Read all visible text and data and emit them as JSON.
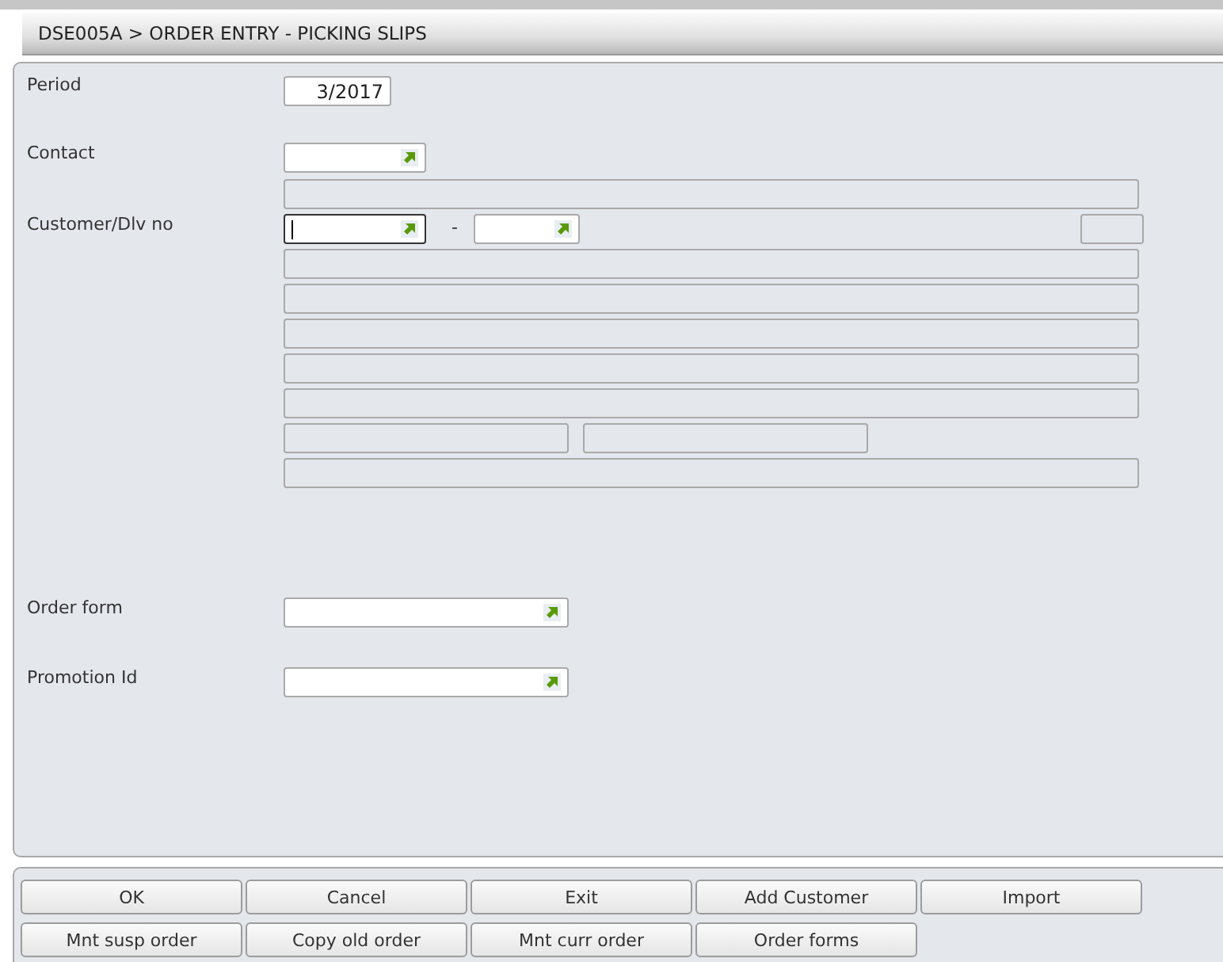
{
  "title": "DSE005A > ORDER ENTRY - PICKING SLIPS",
  "period": {
    "label": "Period",
    "value": "3/2017"
  },
  "contact": {
    "label": "Contact",
    "focused": false
  },
  "customer": {
    "label": "Customer/Dlv no",
    "separator": "-",
    "customer_focused": true,
    "delivery_focused": false
  },
  "order_form": {
    "label": "Order form",
    "focused": false
  },
  "promotion": {
    "label": "Promotion Id",
    "focused": false
  },
  "buttons": [
    [
      "OK",
      "Cancel",
      "Exit",
      "Add Customer",
      "Import"
    ],
    [
      "Mnt susp order",
      "Copy old order",
      "Mnt curr order",
      "Order forms"
    ]
  ]
}
